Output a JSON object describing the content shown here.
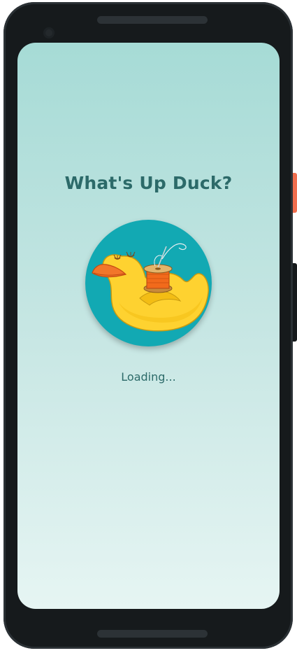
{
  "app": {
    "title": "What's Up Duck?",
    "status_text": "Loading..."
  },
  "logo": {
    "icon": "duck-with-spool-icon"
  },
  "colors": {
    "title_text": "#2c6a69",
    "background_top": "#a6dbd6",
    "background_bottom": "#e6f5f3",
    "logo_circle": "#12a9b3",
    "duck_body": "#fed230",
    "beak": "#f2762a",
    "spool_thread": "#f26a1b"
  }
}
